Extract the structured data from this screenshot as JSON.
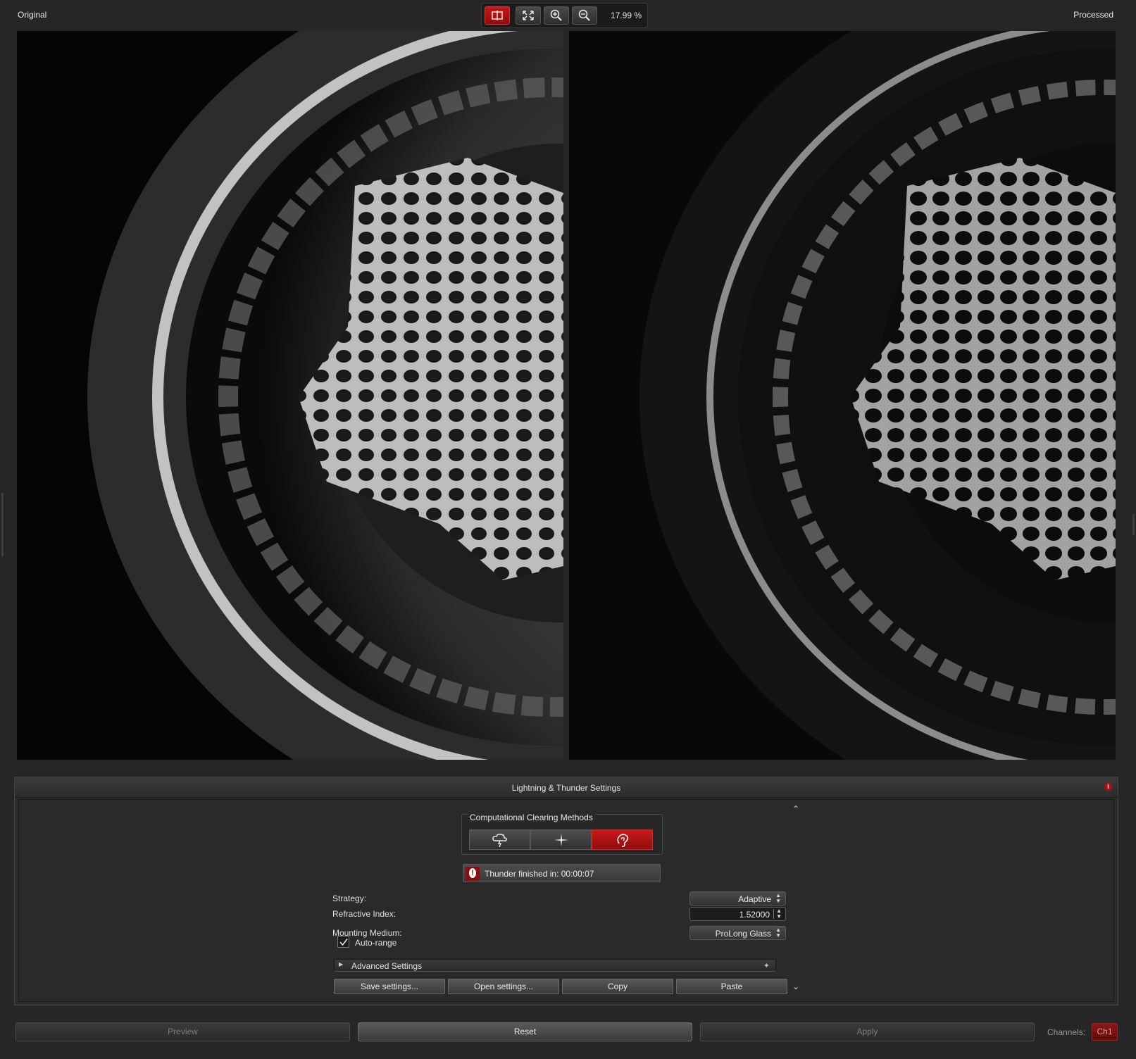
{
  "header": {
    "original_label": "Original",
    "processed_label": "Processed",
    "zoom_text": "17.99 %",
    "tools": [
      {
        "name": "split-view-icon",
        "active": true
      },
      {
        "name": "fit-to-window-icon",
        "active": false
      },
      {
        "name": "zoom-in-icon",
        "active": false
      },
      {
        "name": "zoom-out-icon",
        "active": false
      }
    ]
  },
  "settings": {
    "title": "Lightning & Thunder Settings",
    "ccm_label": "Computational Clearing Methods",
    "ccm_methods": [
      {
        "icon": "lightning-cloud-icon",
        "active": false
      },
      {
        "icon": "sparkle-star-icon",
        "active": false
      },
      {
        "icon": "ear-thunder-icon",
        "active": true
      }
    ],
    "status_text": "Thunder finished in: 00:00:07",
    "strategy_label": "Strategy:",
    "strategy_value": "Adaptive",
    "refractive_label": "Refractive Index:",
    "refractive_value": "1.52000",
    "medium_label": "Mounting Medium:",
    "medium_value": "ProLong Glass",
    "autorange_label": "Auto-range",
    "autorange_checked": true,
    "advanced_label": "Advanced Settings",
    "save_label": "Save settings...",
    "open_label": "Open settings...",
    "copy_label": "Copy",
    "paste_label": "Paste"
  },
  "footer": {
    "preview_label": "Preview",
    "reset_label": "Reset",
    "apply_label": "Apply",
    "channels_label": "Channels:",
    "channel_value": "Ch1"
  },
  "colors": {
    "accent_red": "#b51414",
    "background": "#262626"
  }
}
